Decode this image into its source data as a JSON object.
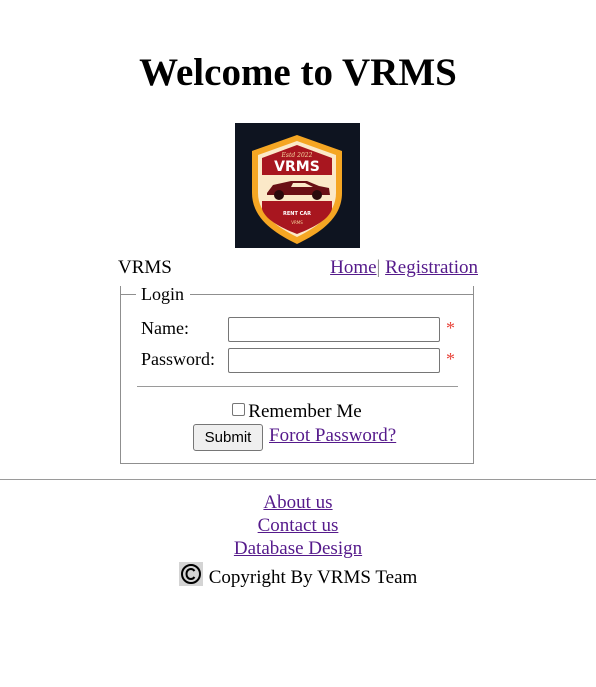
{
  "page": {
    "title": "Welcome to VRMS"
  },
  "logo": {
    "badge_top": "Estd 2022",
    "badge_name": "VRMS",
    "badge_bottom": "RENT CAR",
    "badge_tag": "VRMS",
    "bg_color": "#0e1420",
    "shield_color": "#a8161f",
    "trim_color": "#f5a623"
  },
  "nav": {
    "brand": "VRMS",
    "home": "Home",
    "separator": "|",
    "registration": "Registration"
  },
  "login": {
    "legend": "Login",
    "name_label": "Name:",
    "name_value": "",
    "password_label": "Password:",
    "password_value": "",
    "required_mark": "*",
    "remember_label": "Remember Me",
    "remember_checked": false,
    "submit_label": "Submit",
    "forgot_label": "Forot Password?"
  },
  "footer": {
    "about": "About us",
    "contact": "Contact us",
    "database": "Database Design",
    "copyright": "Copyright By VRMS Team",
    "copyright_icon": "copyright-icon"
  }
}
